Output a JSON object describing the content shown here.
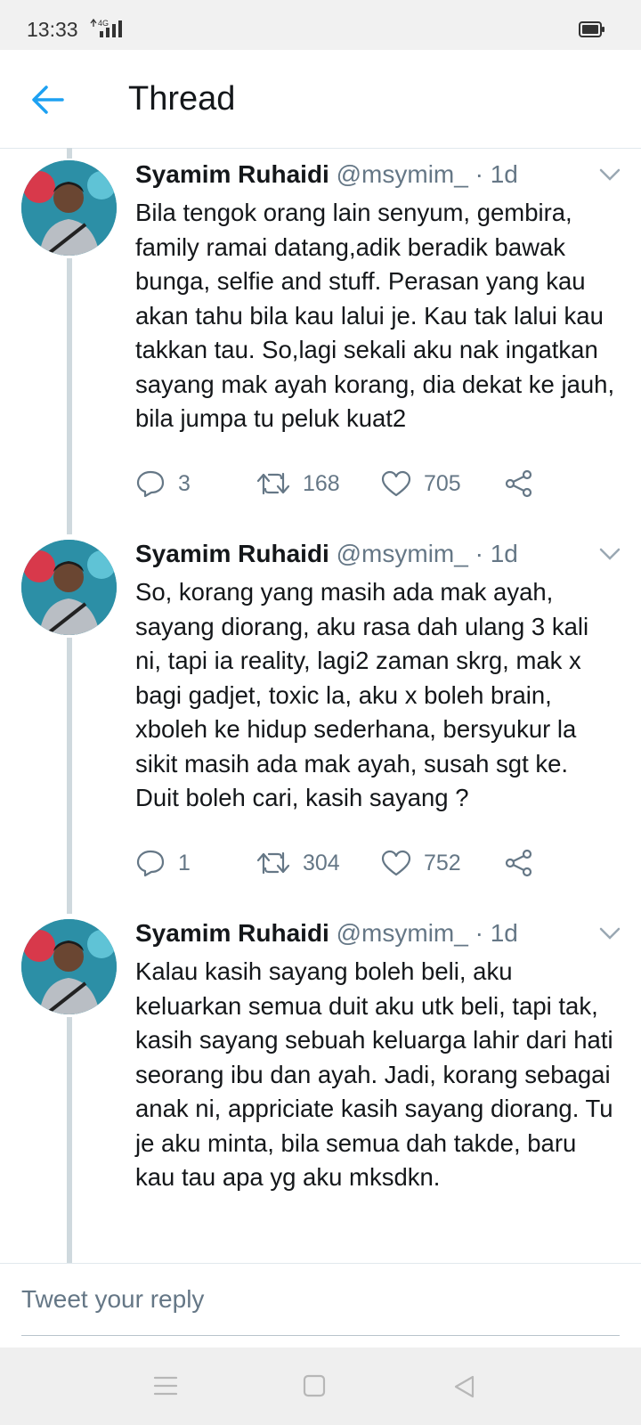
{
  "status": {
    "time": "13:33",
    "network": "4G"
  },
  "appbar": {
    "title": "Thread"
  },
  "tweets": [
    {
      "name": "Syamim Ruhaidi",
      "handle": "@msymim_ · 1d",
      "text": "Bila tengok orang lain senyum, gembira, family ramai datang,adik beradik bawak bunga, selfie and stuff. Perasan yang kau akan tahu bila kau lalui je. Kau tak lalui kau takkan tau. So,lagi sekali aku nak ingatkan sayang mak ayah korang, dia dekat ke jauh, bila jumpa tu peluk kuat2",
      "replies": "3",
      "retweets": "168",
      "likes": "705"
    },
    {
      "name": "Syamim Ruhaidi",
      "handle": "@msymim_ · 1d",
      "text": "So, korang yang masih ada mak ayah, sayang diorang, aku rasa dah ulang 3 kali ni, tapi ia reality, lagi2 zaman skrg, mak x bagi gadjet, toxic la, aku x boleh brain, xboleh ke hidup sederhana, bersyukur la sikit masih ada mak ayah, susah sgt ke. Duit boleh cari, kasih sayang ?",
      "replies": "1",
      "retweets": "304",
      "likes": "752"
    },
    {
      "name": "Syamim Ruhaidi",
      "handle": "@msymim_ · 1d",
      "text": "Kalau kasih sayang boleh beli, aku keluarkan semua duit aku utk beli, tapi tak, kasih sayang sebuah keluarga lahir dari hati seorang ibu dan ayah. Jadi, korang sebagai anak ni, appriciate kasih sayang diorang. Tu je aku minta, bila semua dah takde, baru kau tau apa yg aku mksdkn."
    }
  ],
  "reply": {
    "placeholder": "Tweet your reply"
  },
  "colors": {
    "accent": "#1da1f2",
    "muted": "#657786",
    "thread_line": "#cfd9de"
  },
  "icons": [
    "back-arrow-icon",
    "chevron-down-icon",
    "reply-icon",
    "retweet-icon",
    "like-icon",
    "share-icon",
    "nav-menu-icon",
    "nav-home-icon",
    "nav-back-icon"
  ]
}
